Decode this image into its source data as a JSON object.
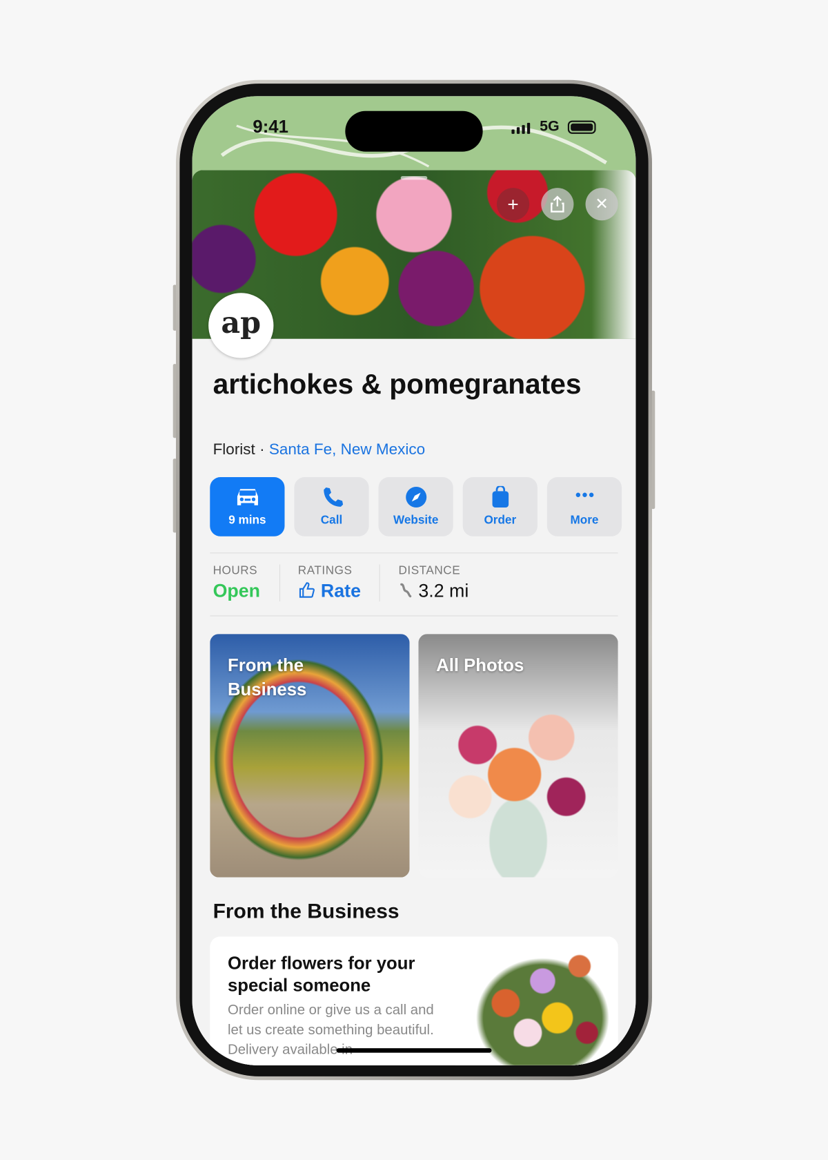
{
  "status_bar": {
    "time": "9:41",
    "network": "5G"
  },
  "place": {
    "name": "artichokes & pomegranates",
    "logo_text": "ap",
    "category": "Florist",
    "separator": "·",
    "location": "Santa Fe, New Mexico"
  },
  "header_buttons": [
    {
      "icon": "plus-icon",
      "glyph": "+"
    },
    {
      "icon": "share-icon"
    },
    {
      "icon": "close-icon",
      "glyph": "✕"
    }
  ],
  "actions": [
    {
      "label": "9 mins",
      "icon": "car-icon",
      "primary": true
    },
    {
      "label": "Call",
      "icon": "phone-icon"
    },
    {
      "label": "Website",
      "icon": "compass-icon"
    },
    {
      "label": "Order",
      "icon": "bag-icon"
    },
    {
      "label": "More",
      "icon": "ellipsis-icon"
    }
  ],
  "info": {
    "hours": {
      "label": "HOURS",
      "value": "Open"
    },
    "ratings": {
      "label": "RATINGS",
      "value": "Rate"
    },
    "distance": {
      "label": "DISTANCE",
      "value": "3.2 mi"
    }
  },
  "photos": [
    {
      "label": "From the Business"
    },
    {
      "label": "All Photos"
    }
  ],
  "section": {
    "title": "From the Business",
    "card": {
      "title": "Order flowers for your special someone",
      "body": "Order online or give us a call and let us create something beautiful. Delivery available in"
    }
  },
  "colors": {
    "accent": "#127bf5",
    "open": "#34c759",
    "map": "#a2c98e"
  }
}
